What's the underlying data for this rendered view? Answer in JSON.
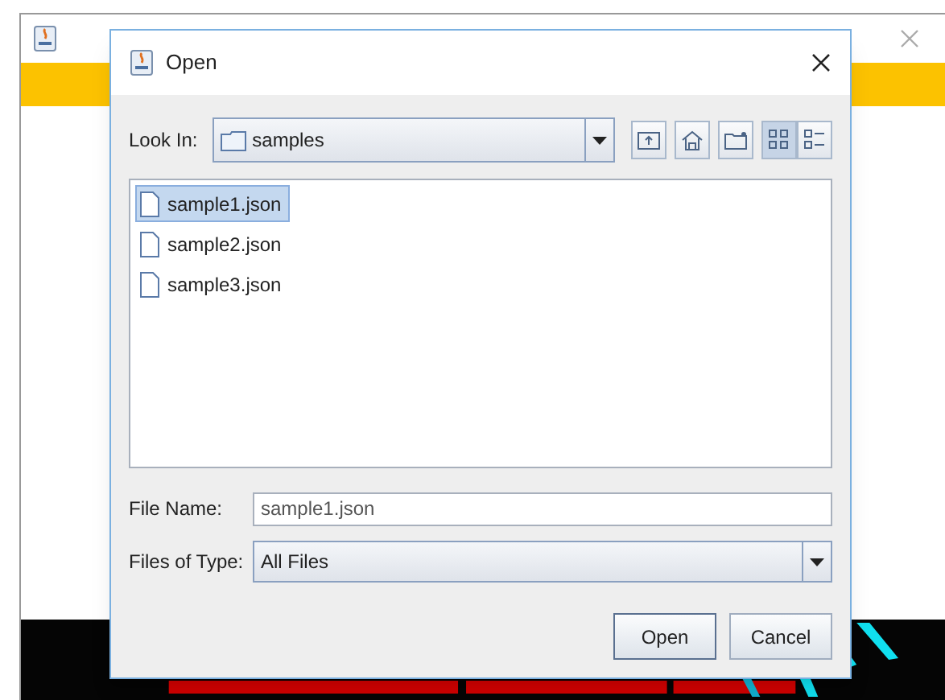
{
  "background_window": {
    "kind": "picture"
  },
  "dialog": {
    "title": "Open"
  },
  "look_in": {
    "label": "Look In:",
    "value": "samples"
  },
  "toolbar": [
    {
      "kind": "up",
      "selected": false
    },
    {
      "kind": "home",
      "selected": false
    },
    {
      "kind": "new-folder",
      "selected": false
    },
    {
      "kind": "list",
      "selected": true
    },
    {
      "kind": "details",
      "selected": false
    }
  ],
  "files": [
    {
      "name": "sample1.json",
      "selected": true
    },
    {
      "name": "sample2.json",
      "selected": false
    },
    {
      "name": "sample3.json",
      "selected": false
    }
  ],
  "file_name": {
    "label": "File Name:",
    "value": "sample1.json"
  },
  "files_of_type": {
    "label": "Files of Type:",
    "value": "All Files"
  },
  "buttons": [
    "Open",
    "Cancel"
  ]
}
